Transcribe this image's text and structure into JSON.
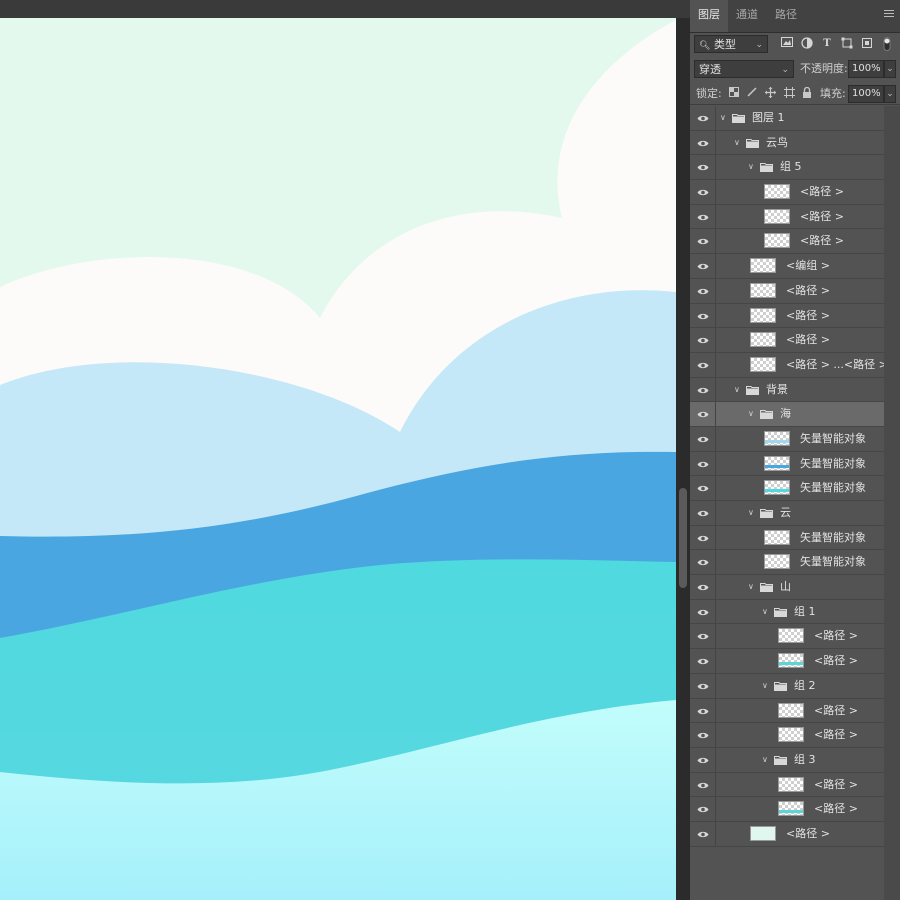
{
  "panel": {
    "tabs": [
      {
        "label": "图层",
        "active": true
      },
      {
        "label": "通道",
        "active": false
      },
      {
        "label": "路径",
        "active": false
      }
    ],
    "filter": {
      "kind_label": "类型",
      "icons": [
        "image-filter-icon",
        "adjustment-filter-icon",
        "type-filter-icon",
        "shape-filter-icon",
        "smart-object-filter-icon"
      ]
    },
    "blend_mode": "穿透",
    "opacity_label": "不透明度:",
    "opacity_value": "100%",
    "lock_label": "锁定:",
    "fill_label": "填充:",
    "fill_value": "100%"
  },
  "layers": [
    {
      "name": "图层 1",
      "type": "group",
      "depth": 0
    },
    {
      "name": "云鸟",
      "type": "group",
      "depth": 1
    },
    {
      "name": "组 5",
      "type": "group",
      "depth": 2
    },
    {
      "name": "<路径 >",
      "type": "layer",
      "depth": 3
    },
    {
      "name": "<路径 >",
      "type": "layer",
      "depth": 3
    },
    {
      "name": "<路径 >",
      "type": "layer",
      "depth": 3
    },
    {
      "name": "<编组 >",
      "type": "layer",
      "depth": 2
    },
    {
      "name": "<路径 >",
      "type": "layer",
      "depth": 2
    },
    {
      "name": "<路径 >",
      "type": "layer",
      "depth": 2
    },
    {
      "name": "<路径 >",
      "type": "layer",
      "depth": 2
    },
    {
      "name": "<路径 > ...<路径 >",
      "type": "layer",
      "depth": 2
    },
    {
      "name": "背景",
      "type": "group",
      "depth": 1
    },
    {
      "name": "海",
      "type": "group",
      "depth": 2,
      "selected": true
    },
    {
      "name": "矢量智能对象",
      "type": "layer",
      "depth": 3,
      "stripe": "#9fd8ef"
    },
    {
      "name": "矢量智能对象",
      "type": "layer",
      "depth": 3,
      "stripe": "#48a6e0"
    },
    {
      "name": "矢量智能对象",
      "type": "layer",
      "depth": 3,
      "stripe": "#4fd8e0"
    },
    {
      "name": "云",
      "type": "group",
      "depth": 2
    },
    {
      "name": "矢量智能对象",
      "type": "layer",
      "depth": 3
    },
    {
      "name": "矢量智能对象",
      "type": "layer",
      "depth": 3
    },
    {
      "name": "山",
      "type": "group",
      "depth": 2
    },
    {
      "name": "组 1",
      "type": "group",
      "depth": 3
    },
    {
      "name": "<路径 >",
      "type": "layer",
      "depth": 4
    },
    {
      "name": "<路径 >",
      "type": "layer",
      "depth": 4,
      "stripe": "#5ad6d6"
    },
    {
      "name": "组 2",
      "type": "group",
      "depth": 3
    },
    {
      "name": "<路径 >",
      "type": "layer",
      "depth": 4
    },
    {
      "name": "<路径 >",
      "type": "layer",
      "depth": 4
    },
    {
      "name": "组 3",
      "type": "group",
      "depth": 3
    },
    {
      "name": "<路径 >",
      "type": "layer",
      "depth": 4
    },
    {
      "name": "<路径 >",
      "type": "layer",
      "depth": 4,
      "stripe": "#5ad6d6"
    },
    {
      "name": "<路径 >",
      "type": "layer",
      "depth": 2,
      "gradient": true
    }
  ],
  "colors": {
    "sky": "#e3f9ee",
    "cloud_white": "#fcfbfa",
    "cloud_blue": "#c4e8f8",
    "sea_blue": "#4aa6e0",
    "sea_cyan": "#4fdadf",
    "sea_light_top": "#c2fdfb",
    "sea_light_bottom": "#a5f0fb"
  }
}
